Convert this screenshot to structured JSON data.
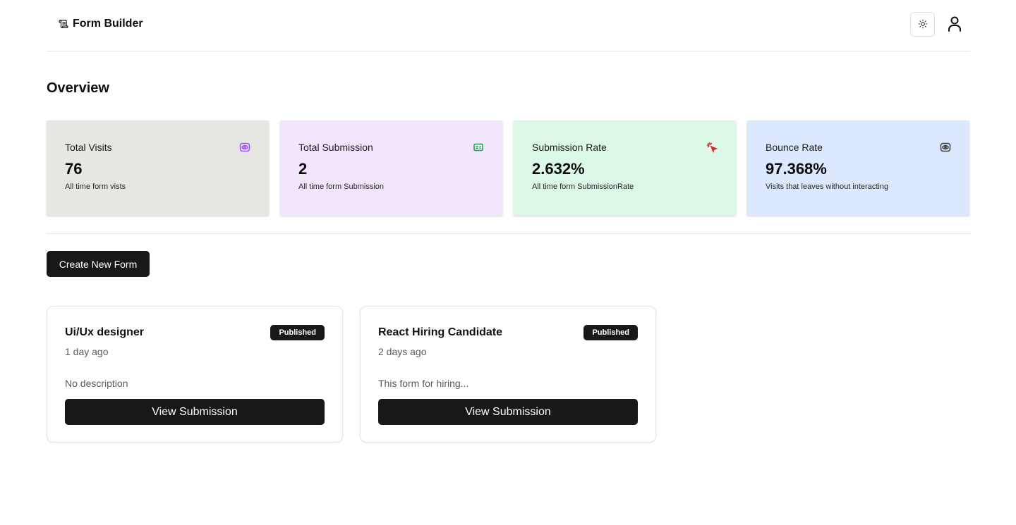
{
  "header": {
    "brand_icon": "scroll-icon",
    "title": "Form Builder",
    "theme_icon": "sun-icon",
    "user_icon": "user-icon"
  },
  "overview": {
    "title": "Overview",
    "stats": [
      {
        "label": "Total Visits",
        "value": "76",
        "help": "All time form vists",
        "icon": "eye-icon",
        "bg": "#e6e6e2",
        "icon_color": "#a855f7"
      },
      {
        "label": "Total Submission",
        "value": "2",
        "help": "All time form Submission",
        "icon": "id-card-icon",
        "bg": "#f2e6fd",
        "icon_color": "#16a34a"
      },
      {
        "label": "Submission Rate",
        "value": "2.632%",
        "help": "All time form SubmissionRate",
        "icon": "pointer-click-icon",
        "bg": "#dcf8e6",
        "icon_color": "#dc2626"
      },
      {
        "label": "Bounce Rate",
        "value": "97.368%",
        "help": "Visits that leaves without interacting",
        "icon": "eye-icon",
        "bg": "#dbe8fd",
        "icon_color": "#404040"
      }
    ]
  },
  "actions": {
    "create_label": "Create New Form"
  },
  "forms": [
    {
      "title": "Ui/Ux designer",
      "status": "Published",
      "time": "1 day ago",
      "description": "No description",
      "button": "View Submission"
    },
    {
      "title": "React Hiring Candidate",
      "status": "Published",
      "time": "2 days ago",
      "description": "This form for hiring...",
      "button": "View Submission"
    }
  ]
}
